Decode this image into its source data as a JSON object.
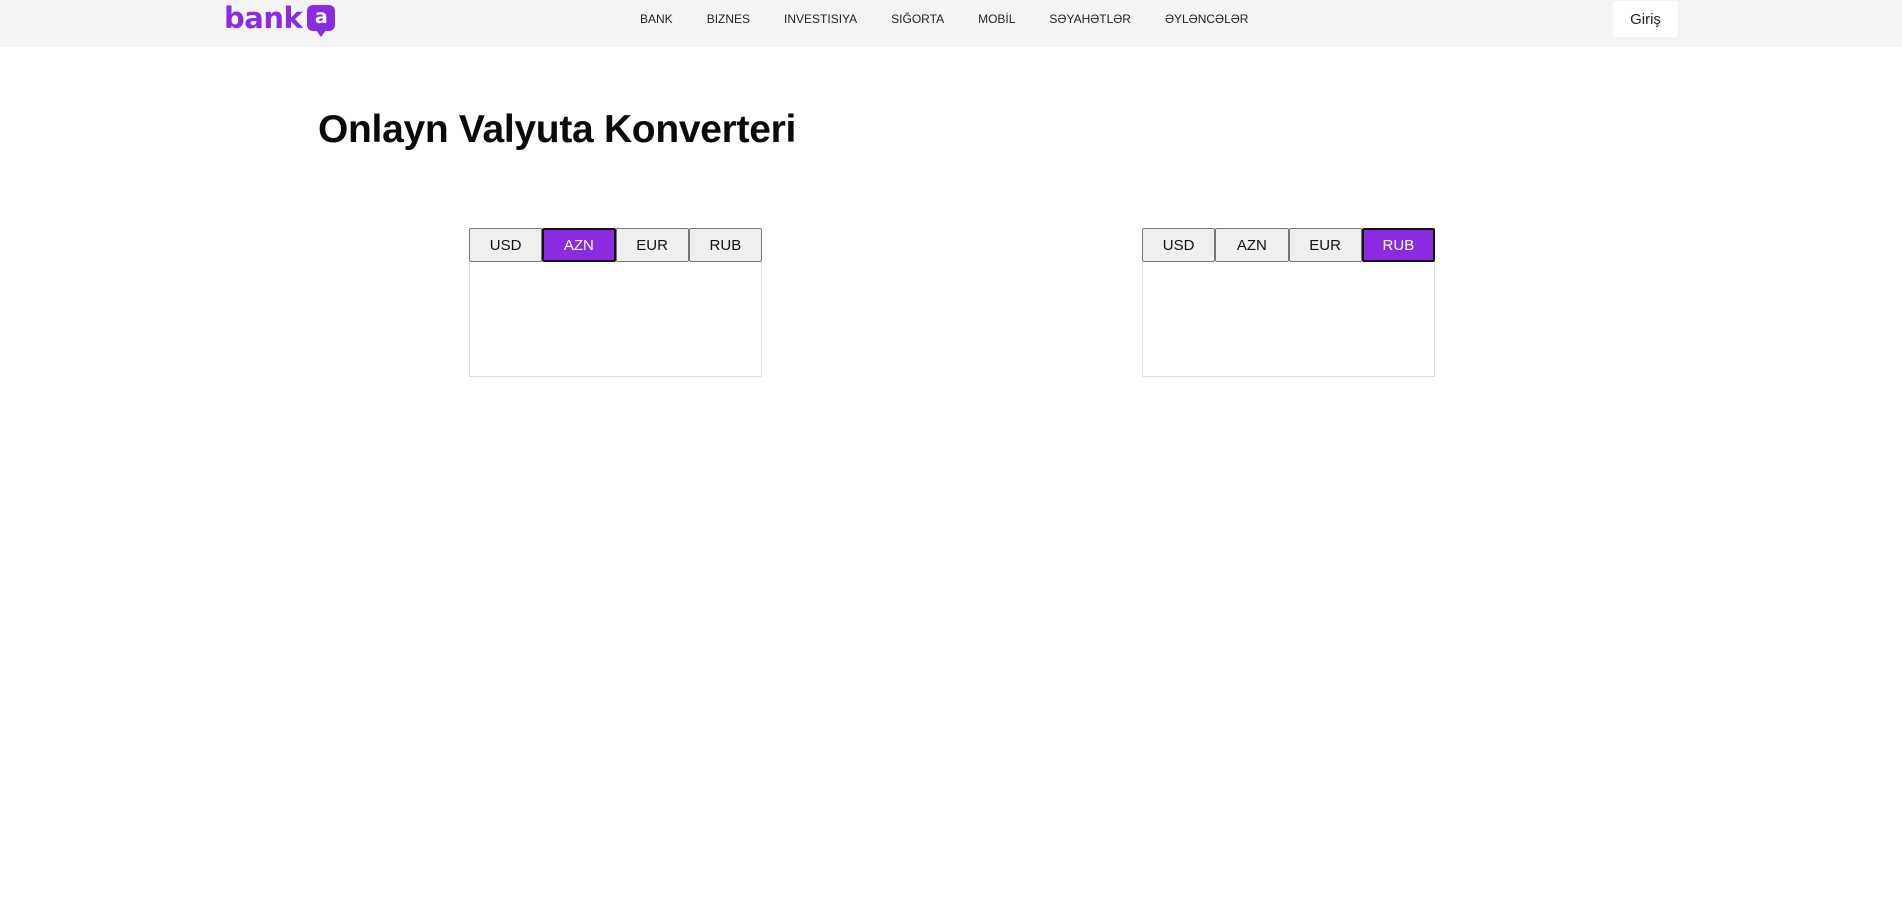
{
  "header": {
    "logo_text": "bank",
    "logo_badge": "a",
    "brand_color": "#8a2be2",
    "nav": [
      {
        "label": "BANK"
      },
      {
        "label": "BIZNES"
      },
      {
        "label": "INVESTISIYA"
      },
      {
        "label": "SIĞORTA"
      },
      {
        "label": "MOBİL"
      },
      {
        "label": "SƏYAHƏTLƏR"
      },
      {
        "label": "ƏYLƏNCƏLƏR"
      }
    ],
    "login_label": "Giriş"
  },
  "main": {
    "title": "Onlayn Valyuta Konverteri",
    "from": {
      "currencies": [
        "USD",
        "AZN",
        "EUR",
        "RUB"
      ],
      "selected": "AZN",
      "amount": ""
    },
    "to": {
      "currencies": [
        "USD",
        "AZN",
        "EUR",
        "RUB"
      ],
      "selected": "RUB",
      "amount": ""
    }
  }
}
